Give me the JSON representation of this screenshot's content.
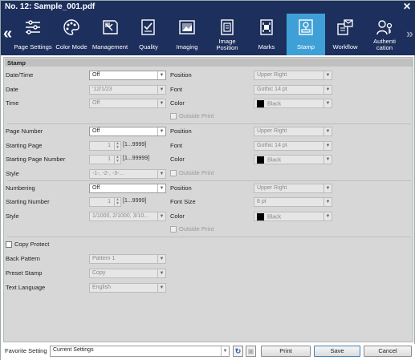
{
  "window": {
    "title": "No. 12: Sample_001.pdf",
    "close": "✕"
  },
  "nav": {
    "left": "«",
    "right": "»"
  },
  "tabs": [
    {
      "label": "Page Settings",
      "icon": "page-settings-icon"
    },
    {
      "label": "Color Mode",
      "icon": "color-mode-icon"
    },
    {
      "label": "Management",
      "icon": "management-icon"
    },
    {
      "label": "Quality",
      "icon": "quality-icon"
    },
    {
      "label": "Imaging",
      "icon": "imaging-icon"
    },
    {
      "label": "Image Position",
      "icon": "image-position-icon"
    },
    {
      "label": "Marks",
      "icon": "marks-icon"
    },
    {
      "label": "Stamp",
      "icon": "stamp-icon",
      "active": true
    },
    {
      "label": "Workflow",
      "icon": "workflow-icon"
    },
    {
      "label": "Authenti cation",
      "icon": "authentication-icon"
    }
  ],
  "section": {
    "title": "Stamp"
  },
  "datetime": {
    "label": "Date/Time",
    "value": "Off",
    "date_label": "Date",
    "date_value": "'12/1/23",
    "time_label": "Time",
    "time_value": "Off",
    "position_label": "Position",
    "position_value": "Upper Right",
    "font_label": "Font",
    "font_value": "Gothic 14 pt",
    "color_label": "Color",
    "color_value": "Black",
    "outside_label": "Outside Print"
  },
  "pagenumber": {
    "label": "Page Number",
    "value": "Off",
    "start_label": "Starting Page",
    "start_value": "1",
    "start_range": "[1...9999]",
    "startnum_label": "Starting Page Number",
    "startnum_value": "1",
    "startnum_range": "[1...99999]",
    "style_label": "Style",
    "style_value": "-1-, -2-, -3-...",
    "position_label": "Position",
    "position_value": "Upper Right",
    "font_label": "Font",
    "font_value": "Gothic 14 pt",
    "color_label": "Color",
    "color_value": "Black",
    "outside_label": "Outside Print"
  },
  "numbering": {
    "label": "Numbering",
    "value": "Off",
    "start_label": "Starting Number",
    "start_value": "1",
    "start_range": "[1...9999]",
    "style_label": "Style",
    "style_value": "1/1000, 2/1000, 3/10...",
    "position_label": "Position",
    "position_value": "Upper Right",
    "fontsize_label": "Font Size",
    "fontsize_value": "8 pt",
    "color_label": "Color",
    "color_value": "Black",
    "outside_label": "Outside Print"
  },
  "copyprotect": {
    "label": "Copy Protect",
    "back_label": "Back Pattern",
    "back_value": "Pattern 1",
    "preset_label": "Preset Stamp",
    "preset_value": "Copy",
    "lang_label": "Text Language",
    "lang_value": "English"
  },
  "footer": {
    "fav_label": "Favorite Setting",
    "fav_value": "Current Settings",
    "print": "Print",
    "save": "Save",
    "cancel": "Cancel"
  }
}
